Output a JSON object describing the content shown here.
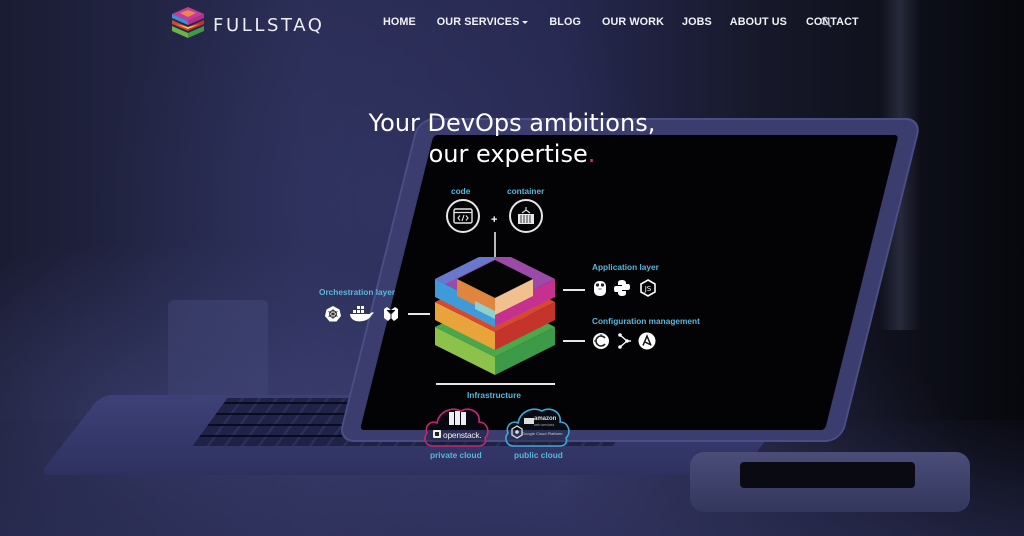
{
  "brand": {
    "name": "FULLSTAQ",
    "logo_icon": "layered-cube-logo"
  },
  "nav": {
    "items": [
      {
        "label": "HOME",
        "has_dropdown": false
      },
      {
        "label": "OUR SERVICES",
        "has_dropdown": true
      },
      {
        "label": "BLOG",
        "has_dropdown": false
      },
      {
        "label": "OUR WORK",
        "has_dropdown": false
      },
      {
        "label": "JOBS",
        "has_dropdown": false
      },
      {
        "label": "ABOUT US",
        "has_dropdown": false
      },
      {
        "label": "CONTACT",
        "has_dropdown": false
      }
    ],
    "search_icon": "search-icon"
  },
  "hero": {
    "title_line1": "Your DevOps ambitions,",
    "title_line2": "our expertise",
    "title_dot": ".",
    "accent_color": "#e3246e"
  },
  "diagram": {
    "code_label": "code",
    "container_label": "container",
    "plus": "+",
    "orchestration_label": "Orchestration layer",
    "orchestration_icons": [
      "kubernetes-icon",
      "docker-icon",
      "mesos-icon"
    ],
    "application_label": "Application layer",
    "application_icons": [
      "go-gopher-icon",
      "python-icon",
      "nodejs-icon"
    ],
    "config_label": "Configuration management",
    "config_icons": [
      "chef-icon",
      "saltstack-icon",
      "ansible-icon"
    ],
    "infrastructure_label": "Infrastructure",
    "private_cloud_label": "private cloud",
    "private_cloud_brand": "openstack.",
    "public_cloud_label": "public cloud",
    "public_cloud_brand_1": "amazon",
    "public_cloud_brand_1_sub": "web services",
    "public_cloud_brand_2": "Google Cloud Platform",
    "label_color": "#58b7db",
    "private_cloud_color": "#c8266f",
    "public_cloud_color": "#3fa7d6"
  }
}
